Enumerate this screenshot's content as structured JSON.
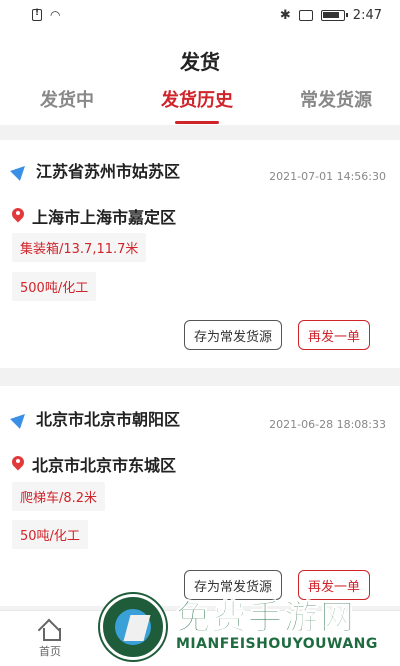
{
  "status_bar": {
    "time": "2:47"
  },
  "header": {
    "title": "发货",
    "tabs": [
      {
        "label": "发货中",
        "active": false
      },
      {
        "label": "发货历史",
        "active": true
      },
      {
        "label": "常发货源",
        "active": false
      }
    ]
  },
  "orders": [
    {
      "origin": "江苏省苏州市姑苏区",
      "timestamp": "2021-07-01 14:56:30",
      "destination": "上海市上海市嘉定区",
      "vehicle": "集装箱/13.7,11.7米",
      "cargo": "500吨/化工",
      "save_label": "存为常发货源",
      "reorder_label": "再发一单"
    },
    {
      "origin": "北京市北京市朝阳区",
      "timestamp": "2021-06-28 18:08:33",
      "destination": "北京市北京市东城区",
      "vehicle": "爬梯车/8.2米",
      "cargo": "50吨/化工",
      "save_label": "存为常发货源",
      "reorder_label": "再发一单"
    }
  ],
  "bottom_nav": {
    "home_label": "首页"
  },
  "watermark": {
    "title": "免费手游网",
    "subtitle": "MIANFEISHOUYOUWANG"
  },
  "colors": {
    "accent": "#d0242b",
    "nav_icon": "#3a8fe6",
    "pin_icon": "#e23a3a",
    "watermark": "#1e6b3f"
  },
  "icons": [
    "sim-alert-icon",
    "wifi-icon",
    "bluetooth-icon",
    "battery-icon",
    "navigation-arrow-icon",
    "location-pin-icon",
    "home-icon"
  ]
}
